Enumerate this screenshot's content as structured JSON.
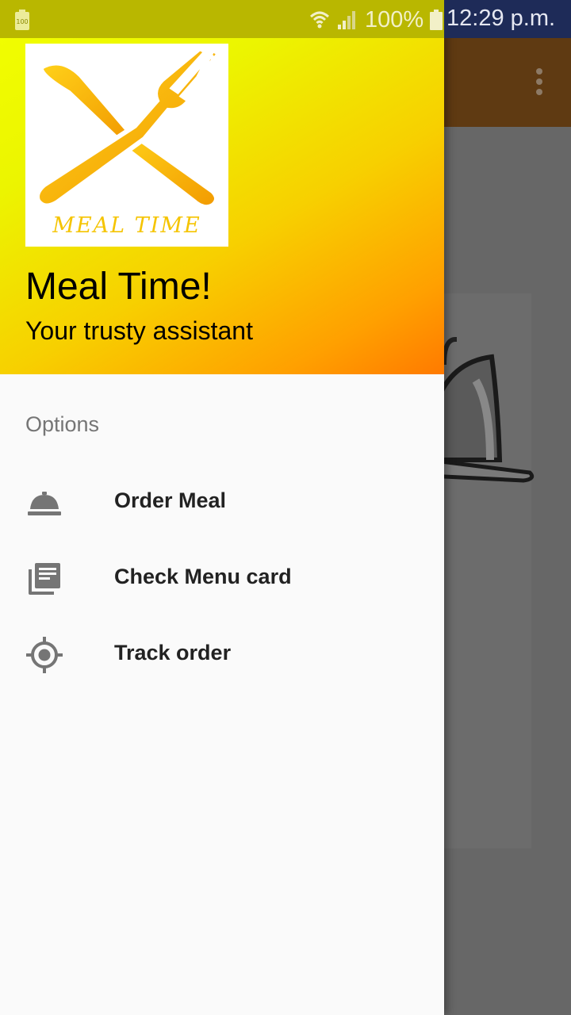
{
  "status_bar": {
    "battery_small_label": "100",
    "battery_percent": "100%",
    "time": "12:29 p.m."
  },
  "drawer": {
    "header": {
      "logo_text": "MEAL TIME",
      "title": "Meal Time!",
      "subtitle": "Your trusty assistant"
    },
    "section_label": "Options",
    "items": [
      {
        "label": "Order Meal",
        "icon": "room-service-icon"
      },
      {
        "label": "Check Menu card",
        "icon": "library-books-icon"
      },
      {
        "label": "Track order",
        "icon": "gps-target-icon"
      }
    ]
  },
  "colors": {
    "app_bar": "#5f3a12",
    "status_bar_dim": "#b9b700",
    "status_bar_right": "#1e2b58",
    "header_gradient_start": "#f2ff00",
    "header_gradient_end": "#ff7a00",
    "logo_yellow": "#f5c400"
  }
}
